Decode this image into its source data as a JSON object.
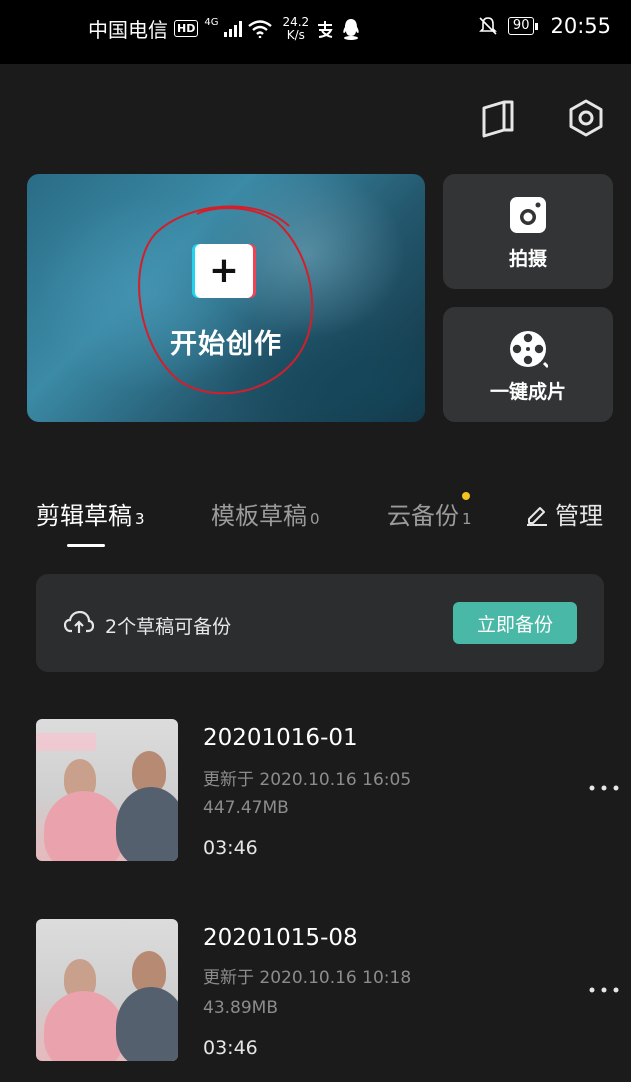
{
  "status_bar": {
    "carrier": "中国电信",
    "hd": "HD",
    "network": "4G",
    "speed_value": "24.2",
    "speed_unit": "K/s",
    "battery": "90",
    "time": "20:55"
  },
  "hero": {
    "label": "开始创作",
    "plus_symbol": "+"
  },
  "side_cards": {
    "camera_label": "拍摄",
    "oneclick_label": "一键成片"
  },
  "tabs": [
    {
      "label": "剪辑草稿",
      "count": "3",
      "active": true
    },
    {
      "label": "模板草稿",
      "count": "0",
      "active": false
    },
    {
      "label": "云备份",
      "count": "1",
      "active": false
    }
  ],
  "manage_label": "管理",
  "backup": {
    "text": "2个草稿可备份",
    "button": "立即备份"
  },
  "drafts": [
    {
      "title": "20201016-01",
      "updated": "更新于 2020.10.16 16:05",
      "size": "447.47MB",
      "duration": "03:46"
    },
    {
      "title": "20201015-08",
      "updated": "更新于 2020.10.16 10:18",
      "size": "43.89MB",
      "duration": "03:46"
    }
  ],
  "colors": {
    "accent": "#49b8a6",
    "background": "#1b1b1b",
    "card": "#333436",
    "notification_dot": "#f2c41c"
  },
  "icons": [
    "book-icon",
    "settings-hex-icon",
    "camera-icon",
    "film-reel-icon",
    "edit-icon",
    "cloud-upload-icon",
    "more-icon"
  ]
}
